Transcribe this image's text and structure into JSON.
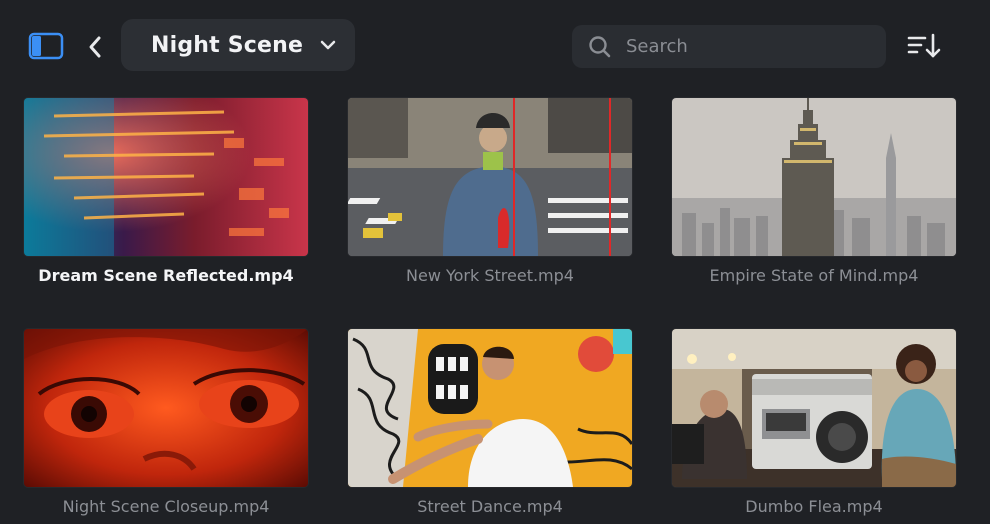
{
  "header": {
    "collection_title": "Night Scene",
    "search_placeholder": "Search"
  },
  "icons": {
    "sidebar": "sidebar-toggle-icon",
    "back": "chevron-left-icon",
    "dropdown": "chevron-down-icon",
    "search": "search-icon",
    "sort": "sort-descending-icon"
  },
  "colors": {
    "accent": "#3b8ff5"
  },
  "videos": [
    {
      "name": "Dream Scene Reflected.mp4",
      "selected": true
    },
    {
      "name": "New York Street.mp4",
      "selected": false
    },
    {
      "name": "Empire State of Mind.mp4",
      "selected": false
    },
    {
      "name": "Night Scene Closeup.mp4",
      "selected": false
    },
    {
      "name": "Street Dance.mp4",
      "selected": false
    },
    {
      "name": "Dumbo Flea.mp4",
      "selected": false
    }
  ]
}
